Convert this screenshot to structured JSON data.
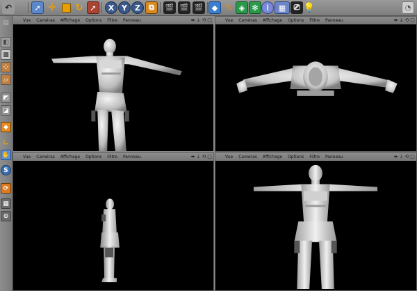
{
  "toolbar": {
    "buttons": [
      {
        "icon": "undo-icon"
      },
      {
        "icon": "select-arrow-icon"
      },
      {
        "icon": "move-icon"
      },
      {
        "icon": "scale-icon"
      },
      {
        "icon": "rotate-icon"
      },
      {
        "icon": "live-select-icon"
      },
      {
        "icon": "x-axis-icon",
        "label": "X"
      },
      {
        "icon": "y-axis-icon",
        "label": "Y"
      },
      {
        "icon": "z-axis-icon",
        "label": "Z"
      },
      {
        "icon": "coordinate-system-icon"
      },
      {
        "icon": "render-view-icon"
      },
      {
        "icon": "render-picture-viewer-icon"
      },
      {
        "icon": "render-settings-icon"
      },
      {
        "icon": "cube-object-icon"
      },
      {
        "icon": "pen-spline-icon"
      },
      {
        "icon": "subdivision-icon"
      },
      {
        "icon": "cloner-icon"
      },
      {
        "icon": "deformer-icon"
      },
      {
        "icon": "floor-icon"
      },
      {
        "icon": "camera-icon"
      },
      {
        "icon": "light-icon"
      },
      {
        "icon": "layout-icon"
      }
    ]
  },
  "left_toolbar": {
    "tools": [
      "model-mode-icon",
      "object-mode-icon",
      "texture-mode-icon",
      "points-mode-icon",
      "edges-mode-icon",
      "polygons-mode-icon",
      "axis-mode-icon",
      "tweak-mode-icon",
      "snap-icon",
      "brush-icon",
      "workplane-icon",
      "locked-workplane-icon"
    ]
  },
  "viewports": [
    {
      "id": "perspective",
      "menu": [
        "Vue",
        "Caméras",
        "Affichage",
        "Options",
        "Filtre",
        "Panneau"
      ],
      "controls": [
        "⬌",
        "⇣",
        "⟲",
        "□"
      ]
    },
    {
      "id": "top",
      "menu": [
        "Vue",
        "Caméras",
        "Affichage",
        "Options",
        "Filtre",
        "Panneau"
      ],
      "controls": [
        "⬌",
        "⇣",
        "⟲",
        "□"
      ]
    },
    {
      "id": "right",
      "menu": [
        "Vue",
        "Caméras",
        "Affichage",
        "Options",
        "Filtre",
        "Panneau"
      ],
      "controls": [
        "⬌",
        "⇣",
        "⟲",
        "□"
      ]
    },
    {
      "id": "front",
      "menu": [
        "Vue",
        "Caméras",
        "Affichage",
        "Options",
        "Filtre",
        "Panneau"
      ],
      "controls": [
        "⬌",
        "⇣",
        "⟲",
        "□"
      ]
    }
  ]
}
